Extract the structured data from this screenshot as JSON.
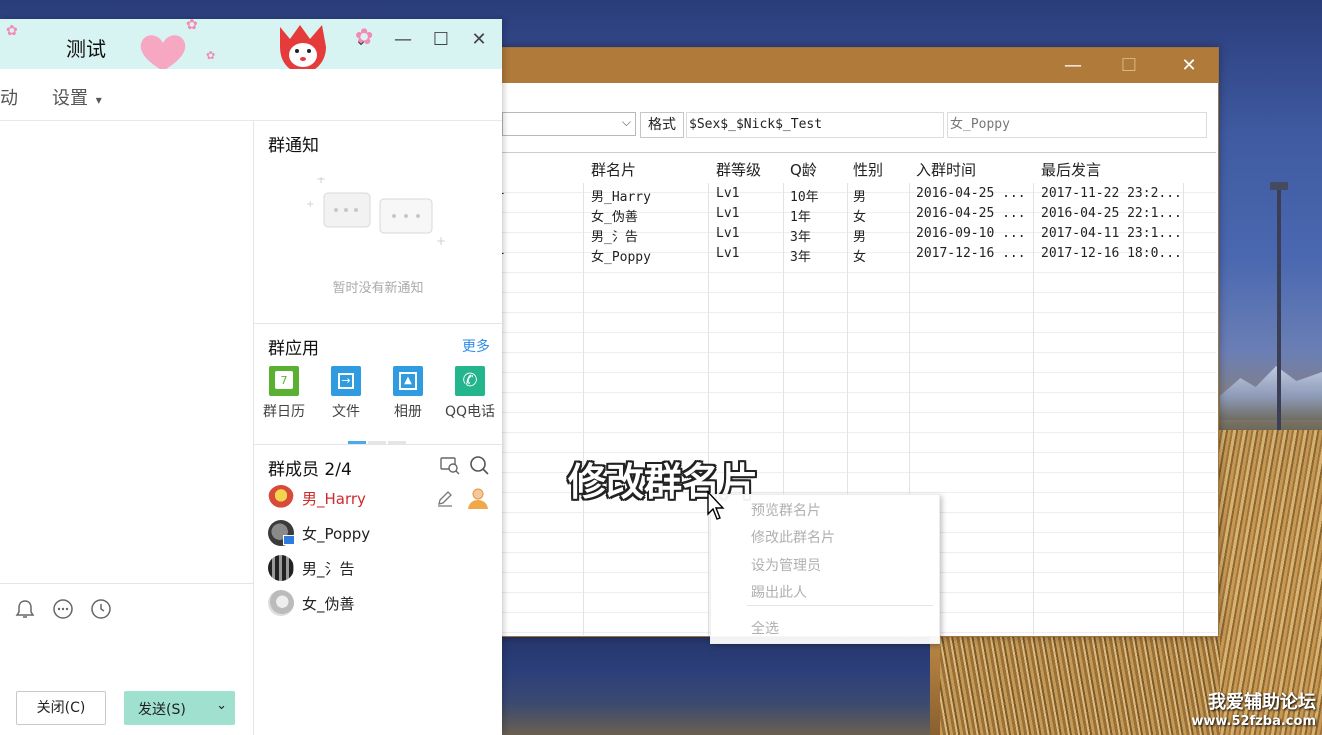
{
  "qq_window": {
    "title": "测试",
    "nav": {
      "partial_label": "动",
      "settings_label": "设置",
      "settings_arrow": "▾"
    },
    "buttons": {
      "close": "关闭(C)",
      "send": "发送(S)",
      "send_arrow": "⌄"
    },
    "notice": {
      "title": "群通知",
      "empty_text": "暂时没有新通知"
    },
    "apps": {
      "title": "群应用",
      "more": "更多",
      "items": [
        {
          "label": "群日历",
          "icon": "calendar-icon",
          "color": "#5ab131",
          "glyph": "7"
        },
        {
          "label": "文件",
          "icon": "file-icon",
          "color": "#2f9be0",
          "glyph": "→"
        },
        {
          "label": "相册",
          "icon": "photo-icon",
          "color": "#2f9be0",
          "glyph": "▲"
        },
        {
          "label": "QQ电话",
          "icon": "phone-icon",
          "color": "#23b58c",
          "glyph": "✆"
        }
      ]
    },
    "members": {
      "title": "群成员 2/4",
      "items": [
        {
          "name": "男_Harry",
          "owner": true
        },
        {
          "name": "女_Poppy",
          "owner": false
        },
        {
          "name": "男_氵告",
          "owner": false
        },
        {
          "name": "女_伪善",
          "owner": false
        }
      ]
    }
  },
  "tool_window": {
    "format_label": "格式",
    "format_value": "$Sex$_$Nick$_Test",
    "preview_value": "女_Poppy",
    "columns": [
      "群名片",
      "群等级",
      "Q龄",
      "性别",
      "入群时间",
      "最后发言"
    ],
    "rows": [
      [
        "男_Harry",
        "Lv1",
        "10年",
        "男",
        "2016-04-25 ...",
        "2017-11-22 23:2..."
      ],
      [
        "女_伪善",
        "Lv1",
        "1年",
        "女",
        "2016-04-25 ...",
        "2016-04-25 22:1..."
      ],
      [
        "男_氵告",
        "Lv1",
        "3年",
        "男",
        "2016-09-10 ...",
        "2017-04-11 23:1..."
      ],
      [
        "女_Poppy",
        "Lv1",
        "3年",
        "女",
        "2017-12-16 ...",
        "2017-12-16 18:0..."
      ]
    ],
    "row_markers": [
      "-",
      "",
      "",
      "-"
    ],
    "caption": "修改群名片",
    "context_menu": [
      "预览群名片",
      "修改此群名片",
      "设为管理员",
      "踢出此人",
      "全选"
    ]
  },
  "watermark": {
    "line1": "我爱辅助论坛",
    "line2": "www.52fzba.com"
  },
  "colors": {
    "accent": "#9fe0cf",
    "title_bar": "#d8f4f2",
    "tool_title": "#b07a3a",
    "link": "#2e8de6",
    "owner_red": "#d02a2a"
  }
}
